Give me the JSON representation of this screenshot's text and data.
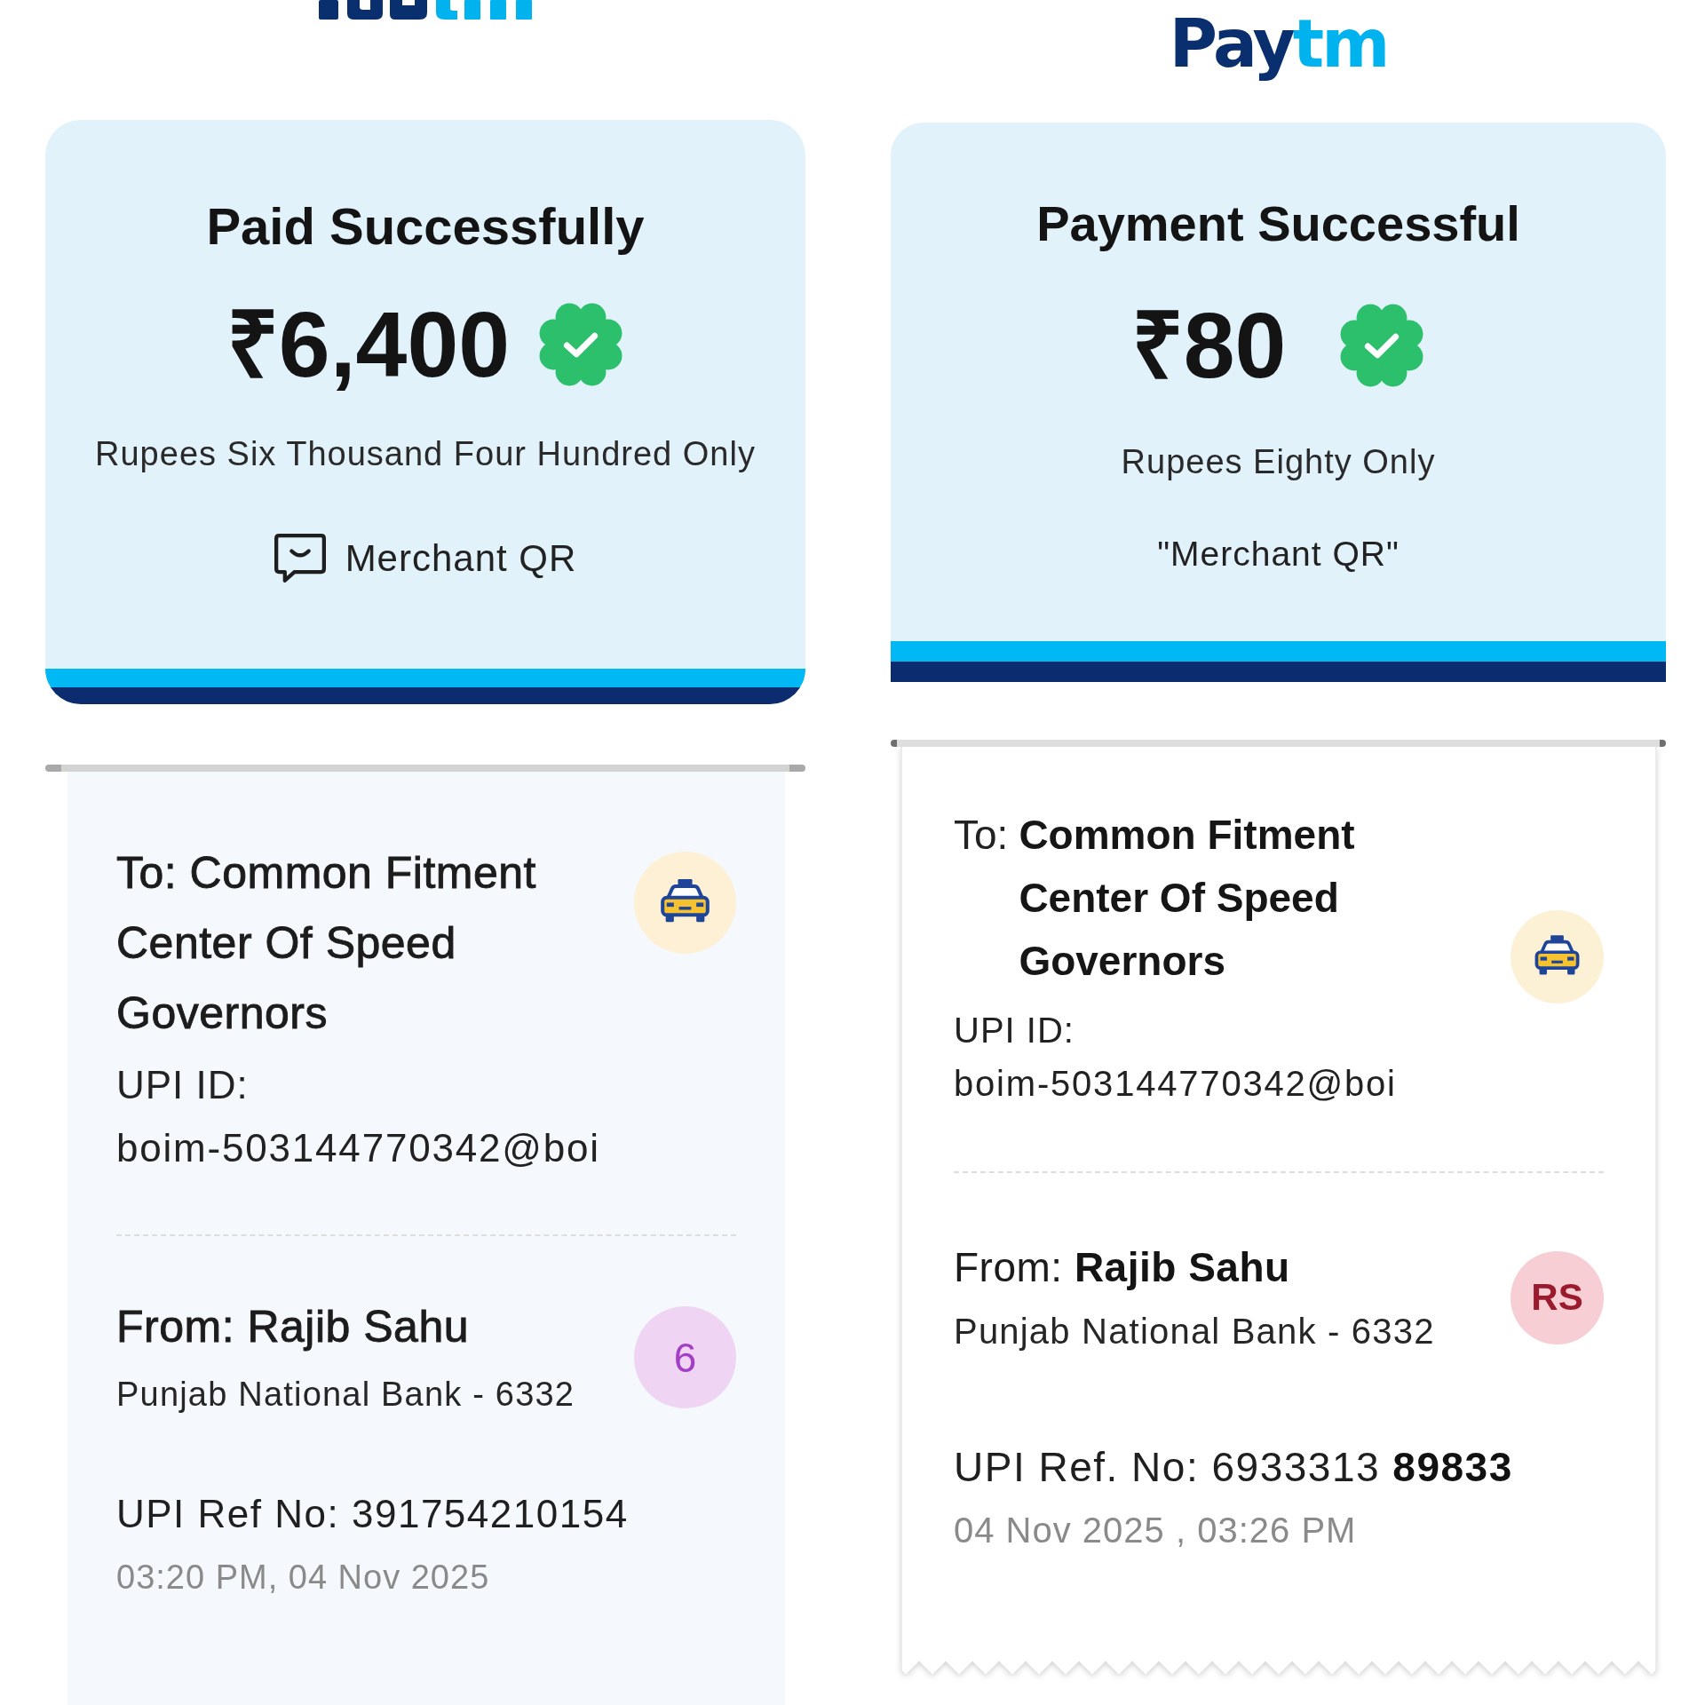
{
  "receipts": [
    {
      "kind": "rounded",
      "title": "Paid Successfully",
      "amount": "₹6,400",
      "amount_words": "Rupees Six Thousand Four Hundred Only",
      "note": "Merchant QR",
      "recipient": {
        "label": "To:",
        "name": "Common Fitment Center Of Speed Governors",
        "upi_label": "UPI ID:",
        "upi_id": "boim-503144770342@boi"
      },
      "sender": {
        "label": "From:",
        "name": "Rajib Sahu",
        "bank": "Punjab National Bank - 6332",
        "avatar": "6"
      },
      "reference": "UPI Ref No: 391754210154",
      "time": "03:20 PM, 04 Nov 2025"
    },
    {
      "kind": "flat",
      "logo": [
        "Pay",
        "tm"
      ],
      "title": "Payment Successful",
      "amount": "₹80",
      "amount_words": "Rupees Eighty Only",
      "note": "\"Merchant QR\"",
      "recipient": {
        "label": "To:",
        "name": "Common Fitment Center Of Speed Governors",
        "upi_label": "UPI ID:",
        "upi_id": "boim-503144770342@boi"
      },
      "sender": {
        "label": "From:",
        "name": "Rajib Sahu",
        "bank": "Punjab National Bank - 6332",
        "avatar": "RS"
      },
      "reference": "UPI Ref. No: 6933313 **89833**",
      "time": "04 Nov 2025 , 03:26 PM"
    }
  ]
}
